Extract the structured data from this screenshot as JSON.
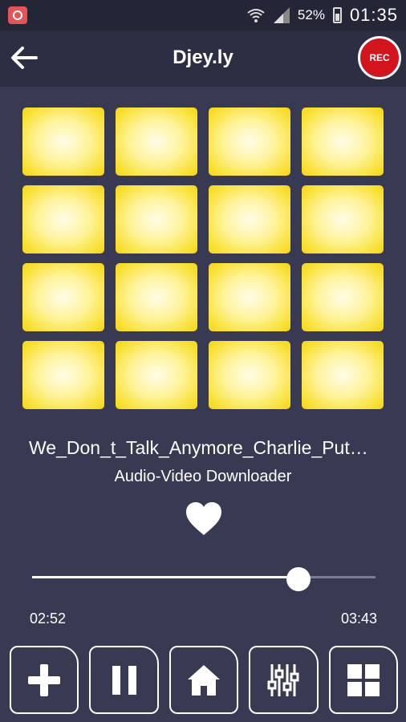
{
  "status_bar": {
    "battery": "52%",
    "time": "01:35",
    "icons": [
      "app-notification-icon",
      "wifi-icon",
      "signal-icon",
      "battery-icon"
    ]
  },
  "app_bar": {
    "title": "Djey.ly",
    "rec_label": "REC",
    "icons": [
      "back-arrow-icon"
    ]
  },
  "pads": {
    "count": 16,
    "color": "#f9df2e"
  },
  "player": {
    "track_title": "We_Don_t_Talk_Anymore_Charlie_Put…",
    "source": "Audio-Video Downloader",
    "current_time": "02:52",
    "total_time": "03:43",
    "progress": 0.775,
    "favorite_icon": "heart-icon"
  },
  "controls": [
    {
      "name": "add-button",
      "icon": "plus-icon"
    },
    {
      "name": "pause-button",
      "icon": "pause-icon"
    },
    {
      "name": "home-button",
      "icon": "home-icon"
    },
    {
      "name": "equalizer-button",
      "icon": "equalizer-icon"
    },
    {
      "name": "pad-grid-button",
      "icon": "grid-icon"
    }
  ],
  "colors": {
    "background": "#373a52",
    "app_bar": "#2c2f44",
    "rec": "#d2141c",
    "accent": "#ffffff"
  }
}
